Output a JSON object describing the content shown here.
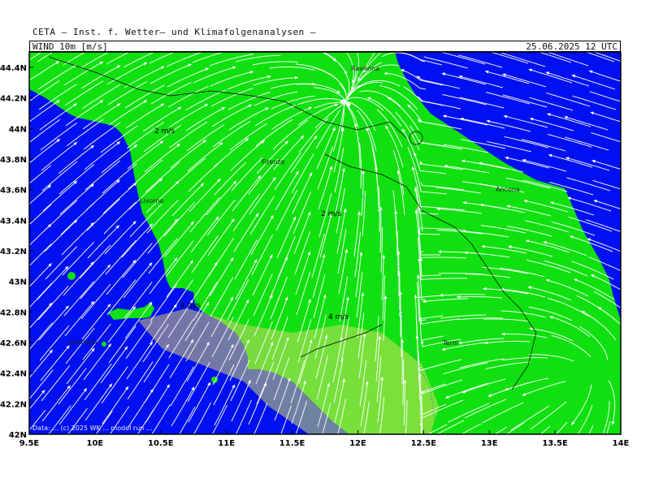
{
  "header": {
    "title": "CETA — Inst. f. Wetter— und Klimafolgenanalysen —",
    "field_label": "WIND 10m [m/s]",
    "valid_time": "25.06.2025 12 UTC"
  },
  "axes": {
    "lat_ticks": [
      "44.4N",
      "44.2N",
      "44N",
      "43.8N",
      "43.6N",
      "43.4N",
      "43.2N",
      "43N",
      "42.8N",
      "42.6N",
      "42.4N",
      "42.2N",
      "42N"
    ],
    "lon_ticks": [
      "9.5E",
      "10E",
      "10.5E",
      "11E",
      "11.5E",
      "12E",
      "12.5E",
      "13E",
      "13.5E",
      "14E"
    ]
  },
  "cities": [
    {
      "name": "Ravenna"
    },
    {
      "name": "Firenze"
    },
    {
      "name": "Livorno"
    },
    {
      "name": "Ancona"
    },
    {
      "name": "Terni"
    },
    {
      "name": "Grosseto"
    }
  ],
  "speed_labels": [
    "2 m/s",
    "2 m/s",
    "4 m/s",
    "4 m/s"
  ],
  "footer": "Data: ... (c) 2025 WK ... model run ...",
  "colors": {
    "sea": "#0010f0",
    "land": "#10e010",
    "strong_wind": "#b8e060",
    "streamline": "#ffffff",
    "frame": "#000000"
  }
}
